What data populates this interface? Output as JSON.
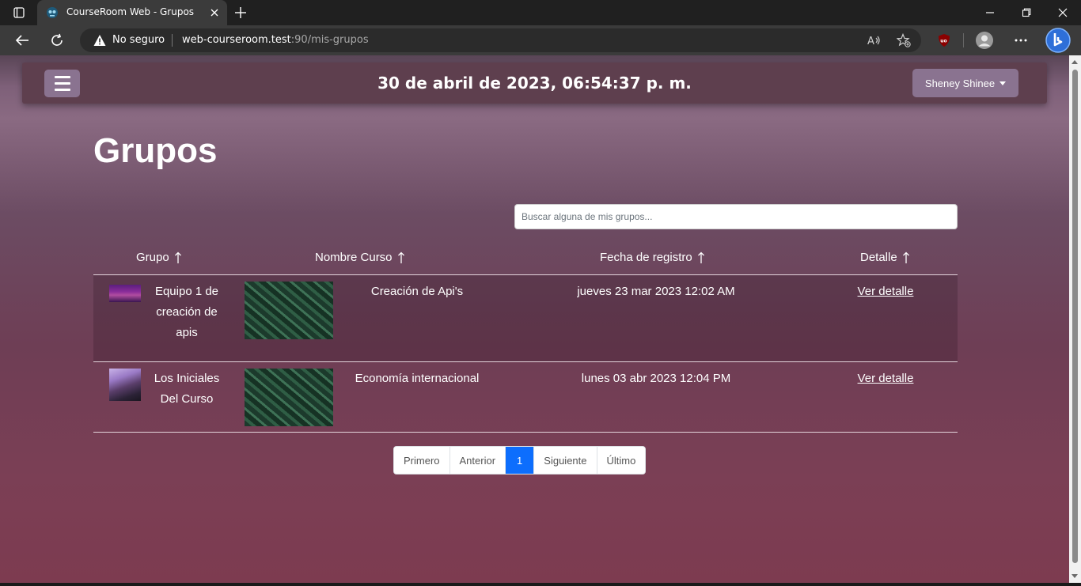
{
  "browser": {
    "tab_title": "CourseRoom Web - Grupos",
    "security_label": "No seguro",
    "url_host": "web-courseroom.test",
    "url_rest": ":90/mis-grupos"
  },
  "app": {
    "datetime": "30 de abril de 2023, 06:54:37 p. m.",
    "user_name": "Sheney Shinee",
    "page_title": "Grupos",
    "search_placeholder": "Buscar alguna de mis grupos..."
  },
  "table": {
    "columns": [
      "Grupo",
      "Nombre Curso",
      "Fecha de registro",
      "Detalle"
    ],
    "rows": [
      {
        "group_name": "Equipo 1 de creación de apis",
        "course_name": "Creación de Api's",
        "registered": "jueves 23 mar 2023 12:02 AM",
        "detail": "Ver detalle"
      },
      {
        "group_name": "Los Iniciales Del Curso",
        "course_name": "Economía internacional",
        "registered": "lunes 03 abr 2023 12:04 PM",
        "detail": "Ver detalle"
      }
    ]
  },
  "pagination": {
    "first": "Primero",
    "prev": "Anterior",
    "current": "1",
    "next": "Siguiente",
    "last": "Último"
  },
  "colors": {
    "accent": "#0d6efd",
    "nav_bg": "#5e3f4e",
    "button_bg": "#8a7390"
  }
}
